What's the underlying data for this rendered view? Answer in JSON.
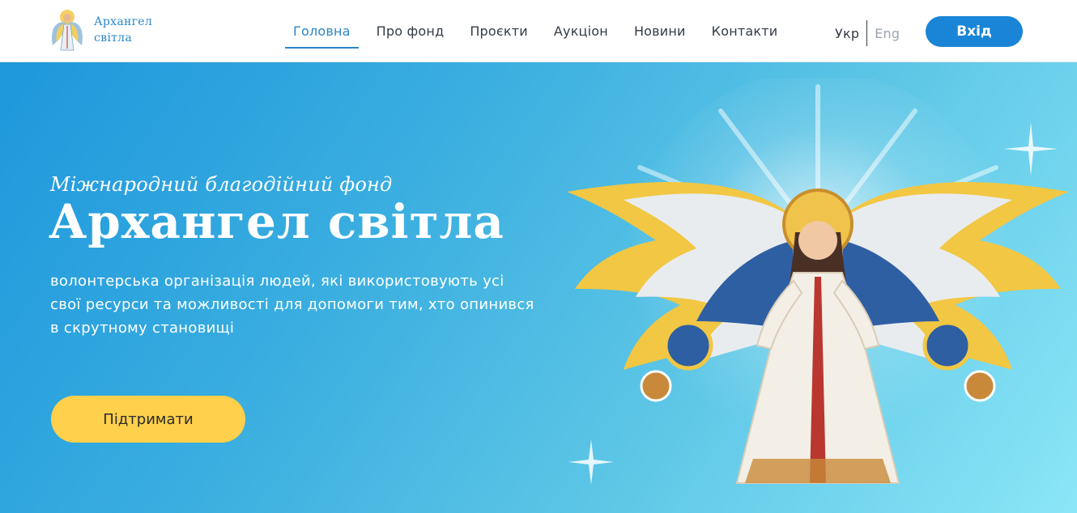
{
  "header": {
    "logo": {
      "line1": "Архангел",
      "line2": "світла"
    },
    "nav": [
      {
        "label": "Головна",
        "active": true
      },
      {
        "label": "Про фонд",
        "active": false
      },
      {
        "label": "Проєкти",
        "active": false
      },
      {
        "label": "Аукціон",
        "active": false
      },
      {
        "label": "Новини",
        "active": false
      },
      {
        "label": "Контакти",
        "active": false
      }
    ],
    "lang": {
      "ua": "Укр",
      "en": "Eng",
      "active": "ua"
    },
    "login_label": "Вхід"
  },
  "hero": {
    "subtitle": "Міжнародний благодійний фонд",
    "title": "Архангел світла",
    "description": "волонтерська організація людей, які використовують усі свої ресурси та можливості для допомоги тим, хто опинився в скрутному становищі",
    "cta_label": "Підтримати"
  },
  "colors": {
    "accent": "#2a86c9",
    "button_blue": "#1a85d6",
    "button_yellow": "#fed04b",
    "hero_gradient_start": "#1e97dc",
    "hero_gradient_end": "#8be6f7"
  },
  "icons": [
    "logo-angel-icon",
    "sparkle-icon"
  ]
}
